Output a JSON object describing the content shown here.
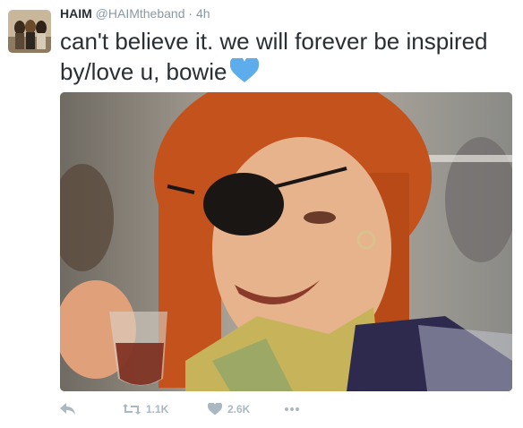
{
  "tweet": {
    "display_name": "HAIM",
    "handle": "@HAIMtheband",
    "separator": "·",
    "time": "4h",
    "text": "can't believe it. we will forever be inspired by/love u, bowie",
    "emoji": "blue-heart",
    "media": {
      "description_icon": "photo"
    }
  },
  "actions": {
    "reply": {
      "icon": "reply-icon"
    },
    "retweet": {
      "icon": "retweet-icon",
      "count": "1.1K"
    },
    "like": {
      "icon": "heart-icon",
      "count": "2.6K"
    },
    "more": {
      "icon": "more-icon"
    }
  },
  "colors": {
    "text": "#292f33",
    "muted": "#8899a6",
    "action": "#aab8c2",
    "heart_emoji": "#5dadec"
  }
}
